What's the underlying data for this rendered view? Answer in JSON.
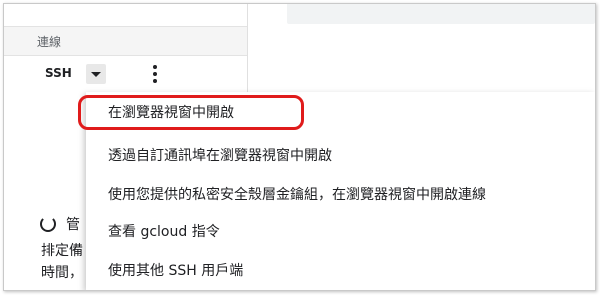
{
  "table": {
    "column_header": "連線",
    "ssh_label": "SSH"
  },
  "card": {
    "title": "管",
    "lines": [
      "排定備",
      "時間，",
      ""
    ]
  },
  "menu": {
    "items": [
      {
        "label": "在瀏覽器視窗中開啟"
      },
      {
        "label": "透過自訂通訊埠在瀏覽器視窗中開啟"
      },
      {
        "label": "使用您提供的私密安全殼層金鑰組，在瀏覽器視窗中開啟連線"
      },
      {
        "label": "查看 gcloud 指令"
      },
      {
        "label": "使用其他 SSH 用戶端"
      }
    ]
  },
  "colors": {
    "highlight": "#e01b1b"
  }
}
